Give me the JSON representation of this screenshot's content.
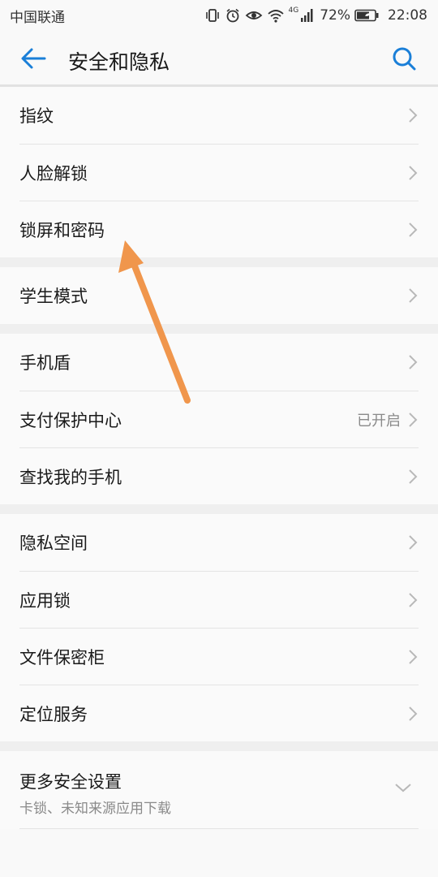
{
  "status_bar": {
    "carrier": "中国联通",
    "network": "4G",
    "battery": "72%",
    "time": "22:08",
    "icons": [
      "vibrate-icon",
      "alarm-icon",
      "eye-comfort-icon",
      "wifi-icon",
      "signal-icon",
      "battery-icon"
    ]
  },
  "header": {
    "title": "安全和隐私",
    "back_icon": "arrow-left-icon",
    "search_icon": "search-icon"
  },
  "groups": [
    {
      "items": [
        {
          "label": "指纹"
        },
        {
          "label": "人脸解锁"
        },
        {
          "label": "锁屏和密码"
        }
      ]
    },
    {
      "items": [
        {
          "label": "学生模式"
        }
      ]
    },
    {
      "items": [
        {
          "label": "手机盾"
        },
        {
          "label": "支付保护中心",
          "value": "已开启"
        },
        {
          "label": "查找我的手机"
        }
      ]
    },
    {
      "items": [
        {
          "label": "隐私空间"
        },
        {
          "label": "应用锁"
        },
        {
          "label": "文件保密柜"
        },
        {
          "label": "定位服务"
        }
      ]
    }
  ],
  "more": {
    "title": "更多安全设置",
    "subtitle": "卡锁、未知来源应用下载"
  },
  "colors": {
    "accent": "#1a7fd8",
    "annotation_arrow": "#f0964c"
  }
}
